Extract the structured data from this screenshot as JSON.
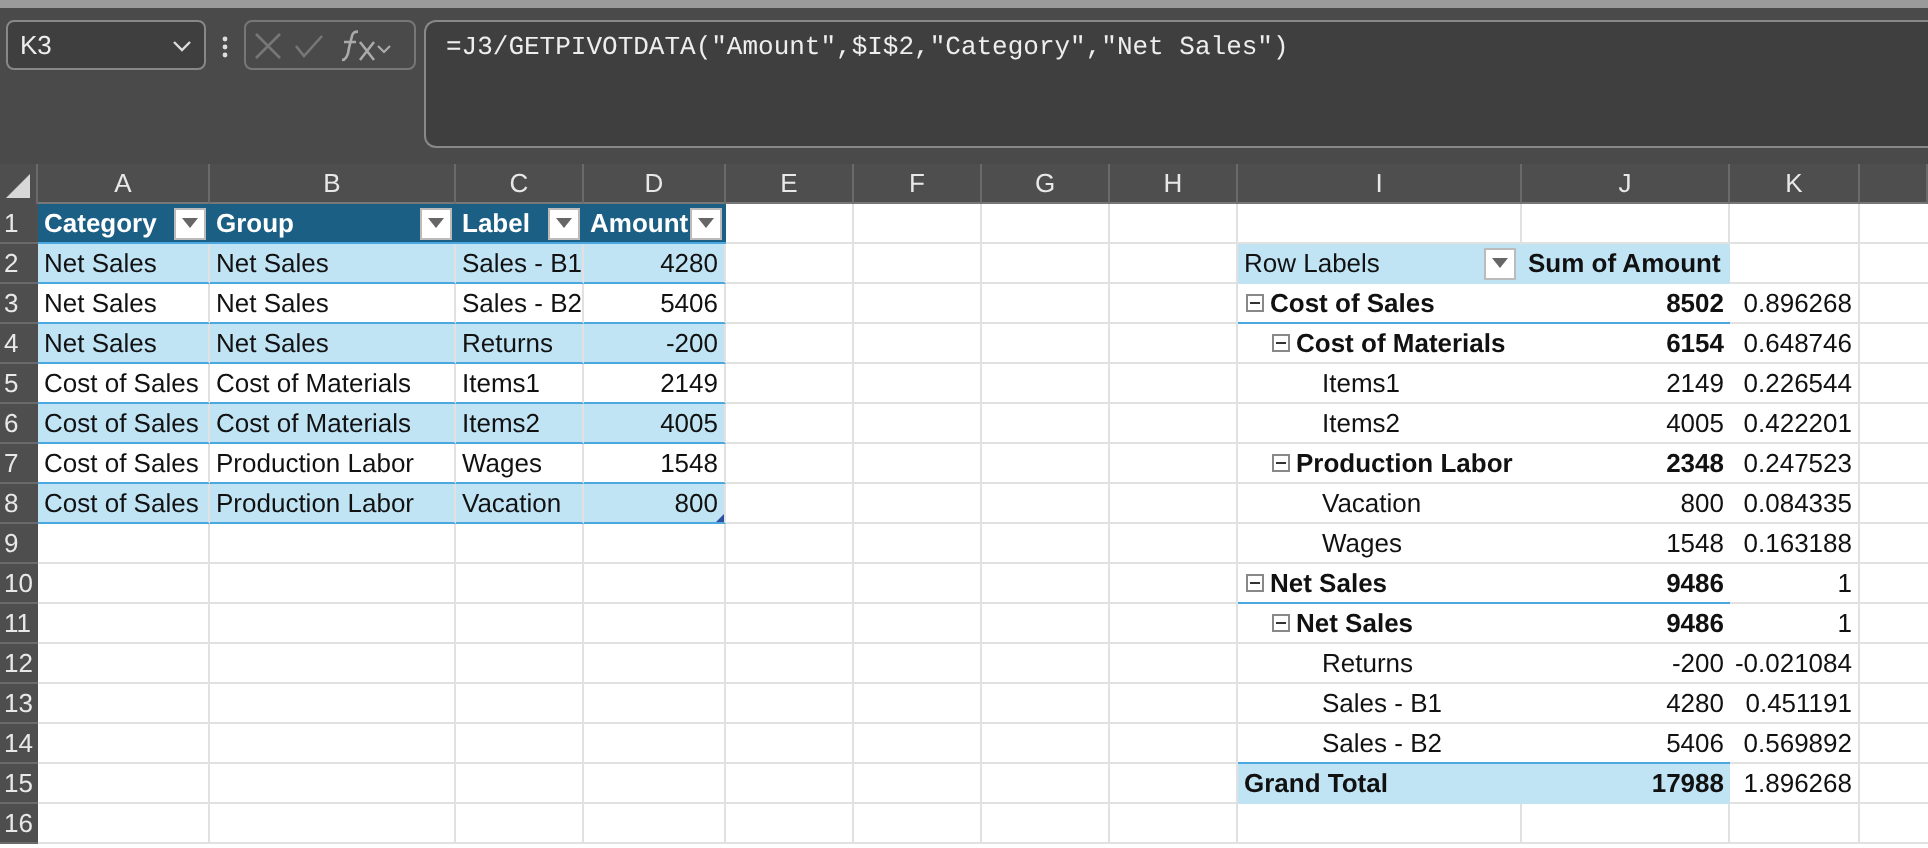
{
  "name_box": {
    "value": "K3"
  },
  "formula_bar": {
    "formula": "=J3/GETPIVOTDATA(\"Amount\",$I$2,\"Category\",\"Net Sales\")"
  },
  "column_headers": [
    "A",
    "B",
    "C",
    "D",
    "E",
    "F",
    "G",
    "H",
    "I",
    "J",
    "K"
  ],
  "row_headers": [
    "1",
    "2",
    "3",
    "4",
    "5",
    "6",
    "7",
    "8",
    "9",
    "10",
    "11",
    "12",
    "13",
    "14",
    "15",
    "16"
  ],
  "table": {
    "columns": [
      "Category",
      "Group",
      "Label",
      "Amount"
    ],
    "rows": [
      [
        "Net Sales",
        "Net Sales",
        "Sales - B1",
        "4280"
      ],
      [
        "Net Sales",
        "Net Sales",
        "Sales - B2",
        "5406"
      ],
      [
        "Net Sales",
        "Net Sales",
        "Returns",
        "-200"
      ],
      [
        "Cost of Sales",
        "Cost of Materials",
        "Items1",
        "2149"
      ],
      [
        "Cost of Sales",
        "Cost of Materials",
        "Items2",
        "4005"
      ],
      [
        "Cost of Sales",
        "Production Labor",
        "Wages",
        "1548"
      ],
      [
        "Cost of Sales",
        "Production Labor",
        "Vacation",
        "800"
      ]
    ]
  },
  "pivot": {
    "header": [
      "Row Labels",
      "Sum of Amount"
    ],
    "rows": [
      {
        "label": "Cost of Sales",
        "value": "8502",
        "ratio": "0.896268",
        "expanded": true,
        "children": [
          {
            "label": "Cost of Materials",
            "value": "6154",
            "ratio": "0.648746",
            "expanded": true,
            "children": [
              {
                "label": "Items1",
                "value": "2149",
                "ratio": "0.226544"
              },
              {
                "label": "Items2",
                "value": "4005",
                "ratio": "0.422201"
              }
            ]
          },
          {
            "label": "Production Labor",
            "value": "2348",
            "ratio": "0.247523",
            "expanded": true,
            "children": [
              {
                "label": "Vacation",
                "value": "800",
                "ratio": "0.084335"
              },
              {
                "label": "Wages",
                "value": "1548",
                "ratio": "0.163188"
              }
            ]
          }
        ]
      },
      {
        "label": "Net Sales",
        "value": "9486",
        "ratio": "1",
        "expanded": true,
        "children": [
          {
            "label": "Net Sales",
            "value": "9486",
            "ratio": "1",
            "expanded": true,
            "children": [
              {
                "label": "Returns",
                "value": "-200",
                "ratio": "-0.021084"
              },
              {
                "label": "Sales - B1",
                "value": "4280",
                "ratio": "0.451191"
              },
              {
                "label": "Sales - B2",
                "value": "5406",
                "ratio": "0.569892"
              }
            ]
          }
        ]
      }
    ],
    "grand_total": {
      "label": "Grand Total",
      "value": "17988",
      "ratio": "1.896268"
    }
  }
}
